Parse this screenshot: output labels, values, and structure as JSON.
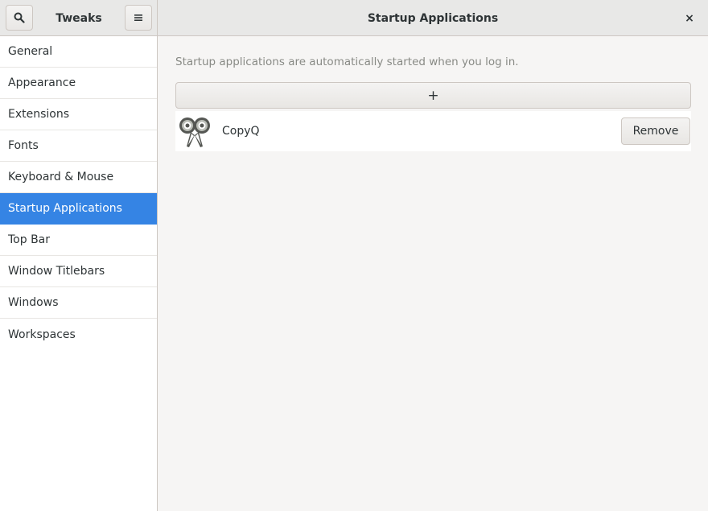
{
  "sidebar_header": {
    "title": "Tweaks",
    "search_icon": "search-icon",
    "menu_icon": "hamburger-menu-icon"
  },
  "main_header": {
    "title": "Startup Applications",
    "close_label": "×"
  },
  "sidebar": {
    "selected": "Startup Applications",
    "items": [
      {
        "label": "General"
      },
      {
        "label": "Appearance"
      },
      {
        "label": "Extensions"
      },
      {
        "label": "Fonts"
      },
      {
        "label": "Keyboard & Mouse"
      },
      {
        "label": "Startup Applications"
      },
      {
        "label": "Top Bar"
      },
      {
        "label": "Window Titlebars"
      },
      {
        "label": "Windows"
      },
      {
        "label": "Workspaces"
      }
    ]
  },
  "main": {
    "description": "Startup applications are automatically started when you log in.",
    "add_label": "+",
    "apps": [
      {
        "name": "CopyQ",
        "icon": "copyq-scissors-icon",
        "remove_label": "Remove"
      }
    ]
  },
  "colors": {
    "accent": "#3584e4",
    "headerbar": "#e8e8e7",
    "background": "#f6f5f4"
  }
}
